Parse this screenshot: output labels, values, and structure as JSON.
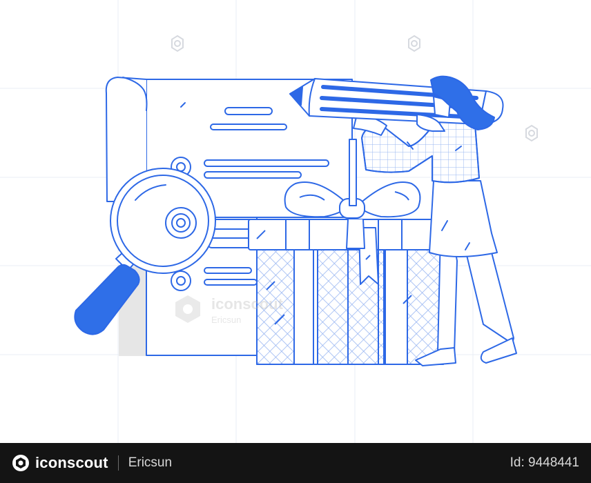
{
  "watermark": {
    "brand": "iconscout",
    "author": "Ericsun"
  },
  "footer": {
    "brand": "iconscout",
    "author": "Ericsun",
    "asset_id": "Id: 9448441"
  },
  "colors": {
    "primary": "#2f6fe8",
    "stroke": "#2d68e6",
    "grey_block": "#e6e6e6",
    "footer_bg": "#141414"
  },
  "icons": [
    "magnifying-glass-icon",
    "pencil-icon",
    "gift-box-icon",
    "certificate-icon",
    "iconscout-logo-icon"
  ]
}
